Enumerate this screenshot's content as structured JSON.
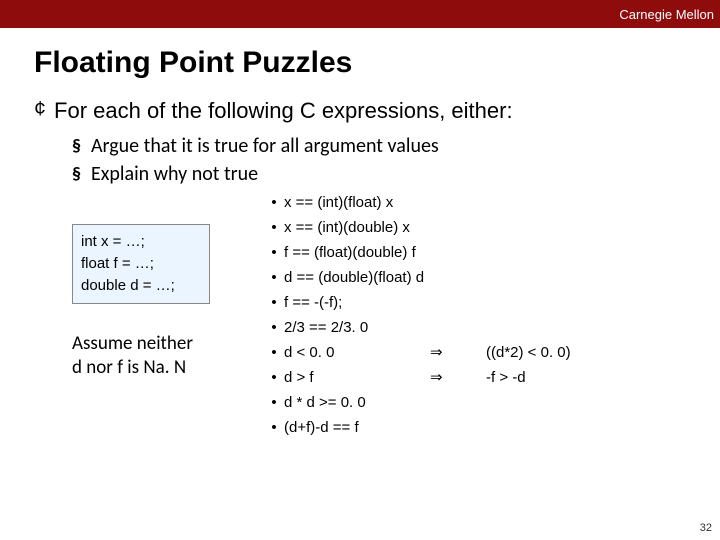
{
  "topbar": {
    "label": "Carnegie Mellon"
  },
  "title": "Floating Point Puzzles",
  "lead": "For each of the following C expressions, either:",
  "subs": [
    "Argue that it is true for all argument values",
    "Explain why not true"
  ],
  "codebox": {
    "l1": "int x = …;",
    "l2": "float f = …;",
    "l3": "double d = …;"
  },
  "assume": "Assume neither\nd nor f is Na. N",
  "exprs": [
    {
      "e": "x == (int)(float) x"
    },
    {
      "e": "x == (int)(double) x"
    },
    {
      "e": "f == (float)(double) f"
    },
    {
      "e": "d == (double)(float) d"
    },
    {
      "e": "f == -(-f);"
    },
    {
      "e": "2/3 == 2/3. 0"
    },
    {
      "e": "d < 0. 0",
      "arrow": "⇒",
      "rhs": "((d*2) < 0. 0)"
    },
    {
      "e": "d > f",
      "arrow": "⇒",
      "rhs": "-f > -d"
    },
    {
      "e": "d * d >= 0. 0"
    },
    {
      "e": "(d+f)-d == f"
    }
  ],
  "pagenum": "32",
  "chart_data": null
}
